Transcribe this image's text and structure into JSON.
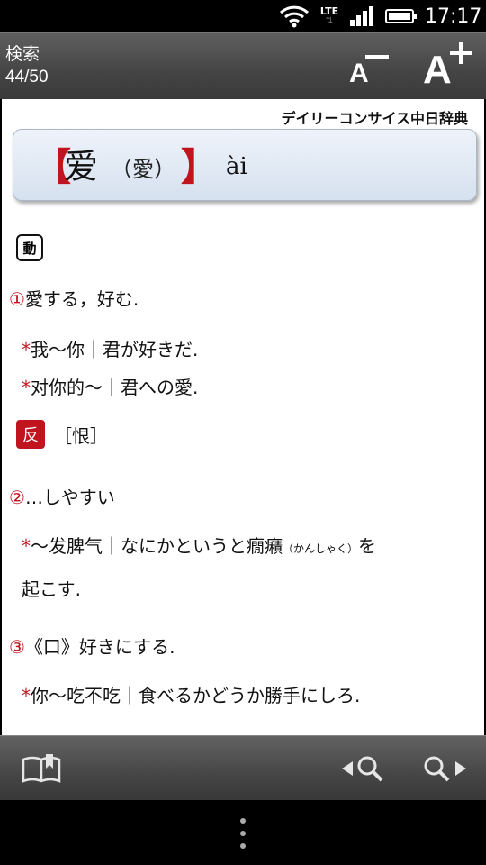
{
  "status_bar": {
    "network": "LTE",
    "network_arrows": "⇅",
    "time": "17:17"
  },
  "header": {
    "title": "検索",
    "count": "44/50",
    "font_smaller_label": "A",
    "font_larger_label": "A"
  },
  "dictionary_name": "デイリーコンサイス中日辞典",
  "entry": {
    "bracket_open": "【",
    "headword": "爱",
    "traditional": "（愛）",
    "bracket_close": "】",
    "pinyin": "ài",
    "pos": "動",
    "sense1": {
      "num": "①",
      "text": "愛する，好む."
    },
    "ex1": {
      "star": "*",
      "text": "我～你｜君が好きだ."
    },
    "ex2": {
      "star": "*",
      "text": "对你的～｜君への愛."
    },
    "antonym_badge": "反",
    "antonym": "［恨］",
    "sense2": {
      "num": "②",
      "text": "…しやすい"
    },
    "ex3": {
      "star": "*",
      "text_a": "～发脾气｜なにかというと癇癪",
      "ruby": "（かんしゃく）",
      "text_b": "を"
    },
    "ex3_cont": "起こす.",
    "sense3": {
      "num": "③",
      "text": "《口》好きにする."
    },
    "ex4": {
      "star": "*",
      "text": "你～吃不吃｜食べるかどうか勝手にしろ."
    }
  },
  "colors": {
    "accent_red": "#c0151f",
    "headword_box": "#dde6f2"
  }
}
